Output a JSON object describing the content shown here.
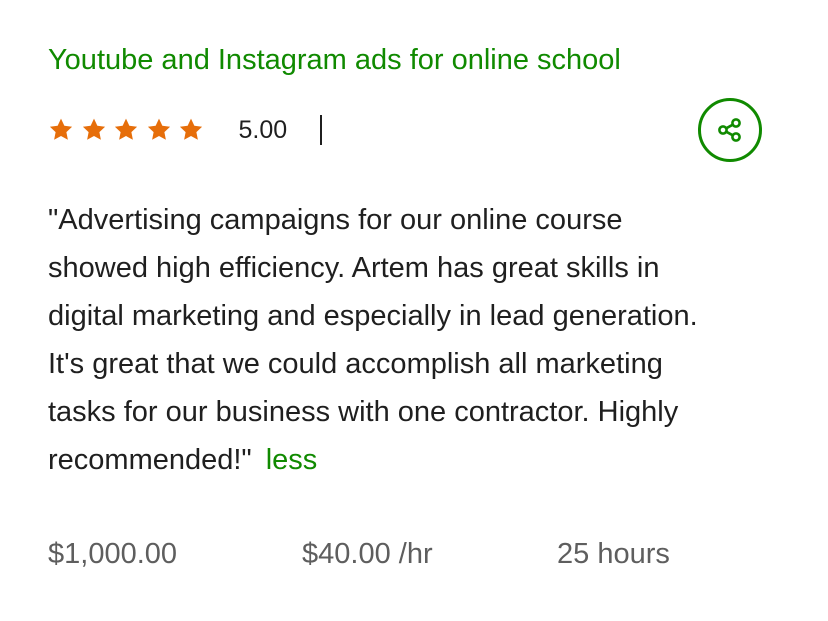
{
  "job": {
    "title": "Youtube and Instagram ads for online school"
  },
  "rating": {
    "stars": 5,
    "max_stars": 5,
    "value": "5.00",
    "star_color": "#e66e0a"
  },
  "share": {
    "icon": "share-icon"
  },
  "review": {
    "lines": [
      "\"Advertising campaigns for our online course",
      "showed high efficiency. Artem has great skills in",
      "digital marketing and especially in lead generation.",
      "It's great that we could accomplish all marketing",
      "tasks for our business with one contractor. Highly",
      "recommended!\""
    ],
    "toggle_label": "less"
  },
  "stats": {
    "earned": "$1,000.00",
    "rate": "$40.00 /hr",
    "hours": "25 hours"
  },
  "colors": {
    "accent": "#108a00",
    "text": "#1f1f1f",
    "muted": "#5e5e5e",
    "star": "#e66e0a"
  }
}
